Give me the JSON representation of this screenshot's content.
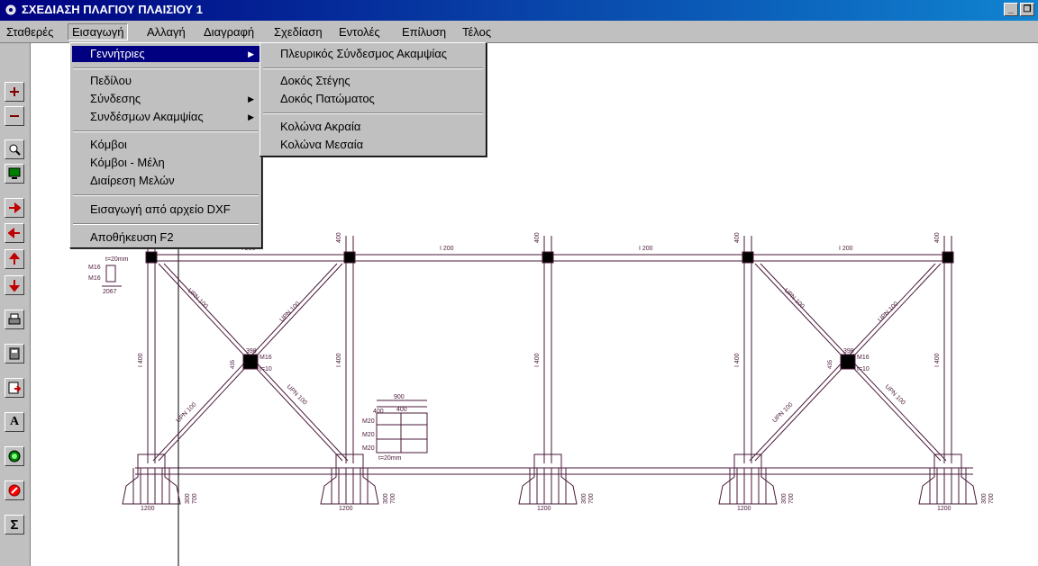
{
  "window": {
    "title": "ΣΧΕΔΙΑΣΗ ΠΛΑΓΙΟΥ ΠΛΑΙΣΙΟΥ 1",
    "icon": "gear-icon",
    "buttons": {
      "minimize": "_",
      "restore": "❐",
      "close": "×"
    }
  },
  "menubar": [
    "Σταθερές",
    "Εισαγωγή",
    "Αλλαγή",
    "Διαγραφή",
    "Σχεδίαση",
    "Εντολές",
    "Επίλυση",
    "Τέλος"
  ],
  "insert_menu": {
    "generators": "Γεννήτριες",
    "footing": "Πεδίλου",
    "connections": "Σύνδεσης",
    "bracing": "Συνδέσμων Ακαμψίας",
    "nodes": "Κόμβοι",
    "nodes_members": "Κόμβοι - Μέλη",
    "split_members": "Διαίρεση Μελών",
    "import_dxf": "Εισαγωγή από αρχείο DXF",
    "save": "Αποθήκευση  F2"
  },
  "generators_submenu": {
    "side_bracing": "Πλευρικός Σύνδεσμος Ακαμψίας",
    "roof_beam": "Δοκός Στέγης",
    "floor_beam": "Δοκός Πατώματος",
    "edge_column": "Κολώνα Ακραία",
    "middle_column": "Κολώνα Μεσαία"
  },
  "toolbar_icons": [
    "zoom-in-plus-icon",
    "zoom-out-minus-icon",
    "zoom-window-icon",
    "display-monitor-icon",
    "pan-right-icon",
    "pan-left-icon",
    "pan-up-icon",
    "pan-down-icon",
    "print-icon",
    "calculator-icon",
    "save-disk-icon",
    "text-icon",
    "target-icon",
    "cancel-icon",
    "sum-icon"
  ],
  "drawing": {
    "beam_labels": [
      "I 200",
      "I 200",
      "I 200",
      "I 200"
    ],
    "column_top_labels": [
      "400",
      "400",
      "400",
      "400",
      "400"
    ],
    "column_mid_labels": [
      "I 400",
      "I 400",
      "I 400",
      "I 400",
      "I 400"
    ],
    "brace_labels": [
      "UPN 100",
      "UPN 100",
      "UPN 100",
      "UPN 100",
      "UPN 100",
      "UPN 100",
      "UPN 100",
      "UPN 100"
    ],
    "gusset_labels": [
      "398",
      "435",
      "M16",
      "t=10"
    ],
    "footing_widths": [
      "1200",
      "1200",
      "1200",
      "1200",
      "1200"
    ],
    "footing_depths": [
      "700",
      "700",
      "700",
      "700",
      "700"
    ],
    "footing_offset": "300",
    "detail_left": [
      "t=20mm",
      "M16",
      "M16",
      "2067"
    ],
    "detail_base": [
      "900",
      "400",
      "400",
      "M20",
      "M20",
      "M20",
      "t=20mm"
    ],
    "colors": {
      "drawing": "#4a1a3a",
      "menu": "#c0c0c0",
      "selection": "#000080"
    }
  }
}
